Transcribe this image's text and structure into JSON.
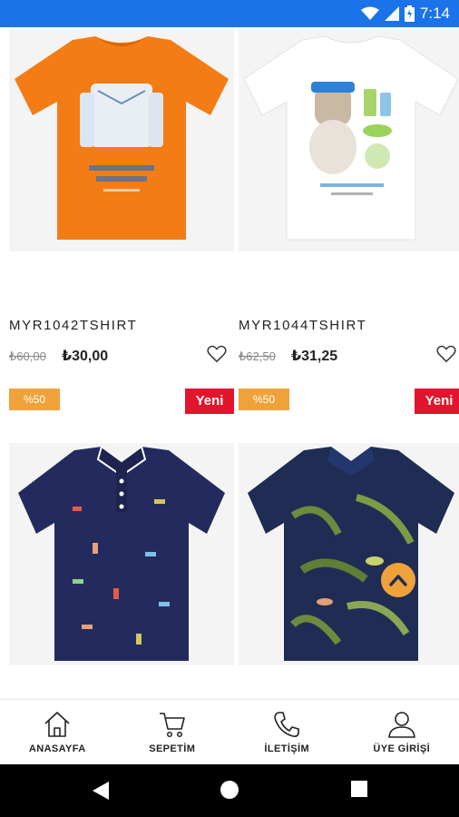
{
  "status_bar": {
    "time": "7:14",
    "background": "#1a73e8"
  },
  "products": [
    {
      "name": "MYR1042TSHIRT",
      "old_price": "₺60,00",
      "price": "₺30,00",
      "discount": "%50",
      "tag": "Yeni",
      "image": "orange-tshirt-jacket-print"
    },
    {
      "name": "MYR1044TSHIRT",
      "old_price": "₺62,50",
      "price": "₺31,25",
      "discount": "%50",
      "tag": "Yeni",
      "image": "white-tshirt-dog-print"
    },
    {
      "image": "navy-polo-pattern"
    },
    {
      "image": "navy-tropical-polo"
    }
  ],
  "bottom_nav": {
    "items": [
      {
        "label": "ANASAYFA",
        "icon": "home-icon"
      },
      {
        "label": "SEPETİM",
        "icon": "cart-icon"
      },
      {
        "label": "İLETİŞİM",
        "icon": "phone-icon"
      },
      {
        "label": "ÜYE GİRİŞİ",
        "icon": "user-icon"
      }
    ]
  },
  "colors": {
    "accent": "#f0a23a",
    "new_tag": "#e3142d",
    "status_bar": "#1a73e8"
  }
}
